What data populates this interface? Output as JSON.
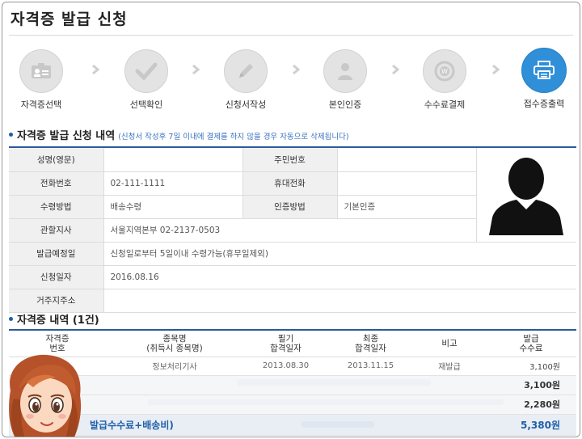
{
  "page": {
    "title": "자격증 발급 신청"
  },
  "steps": [
    {
      "label": "자격증선택",
      "icon": "id-card-icon",
      "active": false
    },
    {
      "label": "선택확인",
      "icon": "checkmark-icon",
      "active": false
    },
    {
      "label": "신청서작성",
      "icon": "pencil-icon",
      "active": false
    },
    {
      "label": "본인인증",
      "icon": "person-icon",
      "active": false
    },
    {
      "label": "수수료결제",
      "icon": "won-coin-icon",
      "active": false
    },
    {
      "label": "접수증출력",
      "icon": "printer-icon",
      "active": true
    }
  ],
  "applicant": {
    "heading": "자격증 발급 신청 내역",
    "note": "(신청서 작성후 7일 이내에 결제를 하지 않을 경우 자동으로 삭제됩니다)",
    "rows": {
      "name_label": "성명(영문)",
      "name_value": "",
      "rrn_label": "주민번호",
      "rrn_value": "",
      "phone_label": "전화번호",
      "phone_value": "02-111-1111",
      "mobile_label": "휴대전화",
      "mobile_value": "",
      "receive_label": "수령방법",
      "receive_value": "배송수령",
      "auth_label": "인증방법",
      "auth_value": "기본인증",
      "branch_label": "관할지사",
      "branch_value": "서울지역본부 02-2137-0503",
      "due_label": "발급예정일",
      "due_value": "신청일로부터 5일이내 수령가능(휴무일제외)",
      "date_label": "신청일자",
      "date_value": "2016.08.16",
      "address_label": "거주지주소",
      "address_value": ""
    }
  },
  "licenses": {
    "heading": "자격증 내역 (1건)",
    "columns": {
      "no_1": "자격증",
      "no_2": "번호",
      "name_1": "종목명",
      "name_2": "(취득시 종목명)",
      "written_1": "필기",
      "written_2": "합격일자",
      "final_1": "최종",
      "final_2": "합격일자",
      "remark": "비고",
      "fee_1": "발급",
      "fee_2": "수수료"
    },
    "items": [
      {
        "number": "",
        "name": "정보처리기사",
        "written_date": "2013.08.30",
        "final_date": "2013.11.15",
        "remark": "재발급",
        "fee": "3,100원"
      }
    ],
    "issue_fee_sum": "3,100원",
    "shipping_fee": "2,280원",
    "total_label": "발급수수료+배송비)",
    "total": "5,380원"
  }
}
